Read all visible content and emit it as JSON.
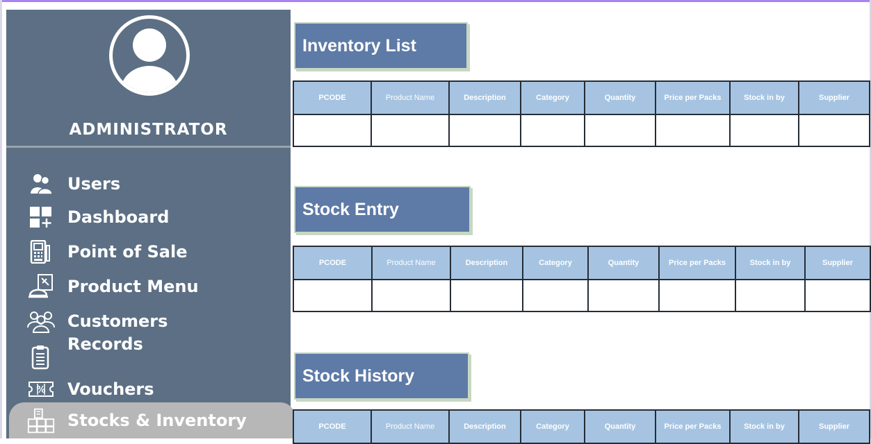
{
  "sidebar": {
    "role": "ADMINISTRATOR",
    "items": [
      {
        "label": "Users",
        "icon": "users-icon"
      },
      {
        "label": "Dashboard",
        "icon": "dashboard-icon"
      },
      {
        "label": "Point of Sale",
        "icon": "pos-terminal-icon"
      },
      {
        "label": "Product Menu",
        "icon": "product-menu-icon"
      },
      {
        "label": "Customers",
        "icon": "customers-icon"
      },
      {
        "label": "Records",
        "icon": "clipboard-icon"
      },
      {
        "label": "Vouchers",
        "icon": "voucher-icon"
      },
      {
        "label": "Stocks & Inventory",
        "icon": "boxes-icon"
      }
    ],
    "active_item": "Stocks & Inventory"
  },
  "columns": [
    "PCODE",
    "Product Name",
    "Description",
    "Category",
    "Quantity",
    "Price per Packs",
    "Stock in by",
    "Supplier"
  ],
  "sections": {
    "inventory": {
      "title": "Inventory List"
    },
    "entry": {
      "title": "Stock Entry"
    },
    "history": {
      "title": "Stock History"
    }
  },
  "colors": {
    "sidebar_bg": "#5c6f84",
    "title_bg": "#5e7aa6",
    "header_bg": "#a6c4e2",
    "active_item_bg": "#b7b7b7",
    "accent_border": "#a784f0"
  }
}
